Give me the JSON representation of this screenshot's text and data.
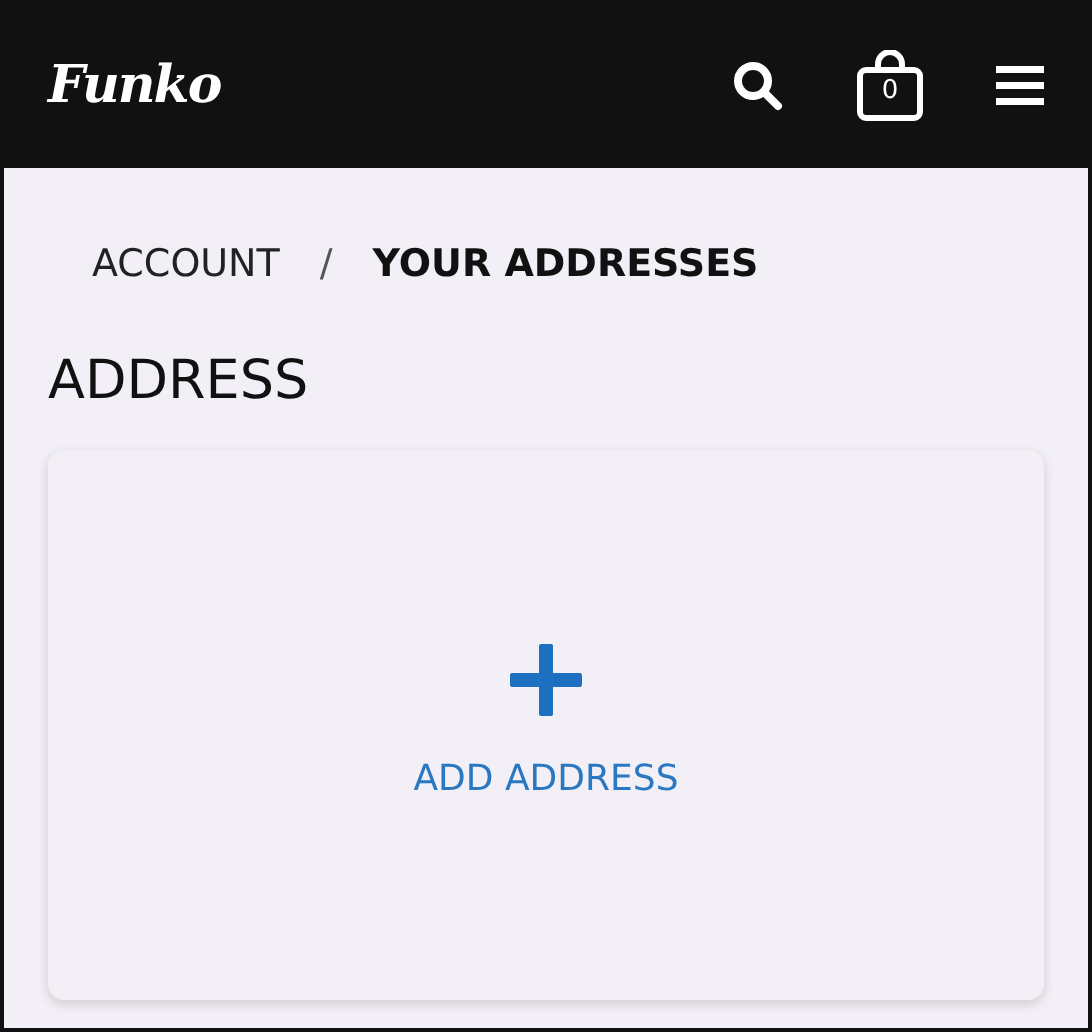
{
  "header": {
    "logo": "Funko",
    "cart_count": "0"
  },
  "breadcrumb": [
    {
      "label": "ACCOUNT",
      "current": false
    },
    {
      "label": "/",
      "kind": "separator"
    },
    {
      "label": "YOUR ADDRESSES",
      "current": true
    }
  ],
  "heading": "ADDRESS",
  "add_address": {
    "label": "ADD ADDRESS"
  }
}
